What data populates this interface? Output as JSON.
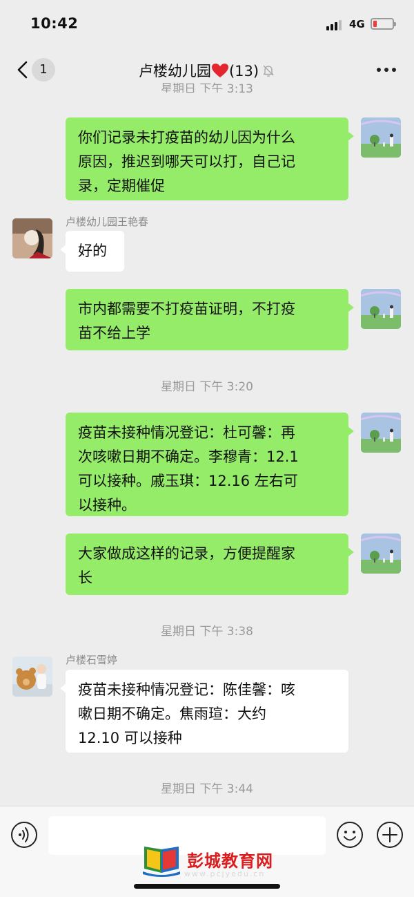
{
  "status": {
    "time": "10:42",
    "network": "4G",
    "battery_level": 0.2
  },
  "header": {
    "back_count": "1",
    "group_name": "卢楼幼儿园",
    "member_count": "(13)",
    "icons": {
      "back": "chevron-left-icon",
      "heart": "red-heart-icon",
      "mute": "mute-bell-icon",
      "more": "more-dots-icon"
    }
  },
  "timestamps": {
    "partial_top": "星期日 下午 3:13",
    "t320": "星期日 下午 3:20",
    "t338": "星期日 下午 3:38",
    "t344": "星期日 下午 3:44"
  },
  "messages": [
    {
      "from": "me",
      "lines": [
        "你们记录未打疫苗的幼儿因为什么",
        "原因，推迟到哪天可以打，自己记",
        "录，定期催促"
      ]
    },
    {
      "from": "other",
      "sender": "卢楼幼儿园王艳春",
      "lines": [
        "好的"
      ]
    },
    {
      "from": "me",
      "lines": [
        "市内都需要不打疫苗证明，不打疫",
        "苗不给上学"
      ]
    },
    {
      "from": "me",
      "lines": [
        "疫苗未接种情况登记：杜可馨：再",
        "次咳嗽日期不确定。李穆青：12.1",
        "可以接种。戚玉琪：12.16 左右可",
        "以接种。"
      ]
    },
    {
      "from": "me",
      "lines": [
        "大家做成这样的记录，方便提醒家",
        "长"
      ]
    },
    {
      "from": "other",
      "sender": "卢楼石雪婷",
      "lines": [
        "疫苗未接种情况登记：陈佳馨：咳",
        "嗽日期不确定。焦雨瑄：大约",
        "12.10 可以接种"
      ]
    }
  ],
  "input_bar": {
    "placeholder": "",
    "icons": {
      "voice": "voice-icon",
      "emoji": "emoji-icon",
      "plus": "plus-icon"
    }
  },
  "watermark": {
    "name": "彭城教育网",
    "url": "www.pcjyedu.cn"
  },
  "colors": {
    "background": "#ededed",
    "my_bubble": "#95ec69",
    "other_bubble": "#ffffff",
    "watermark_red": "#d81e1e"
  }
}
